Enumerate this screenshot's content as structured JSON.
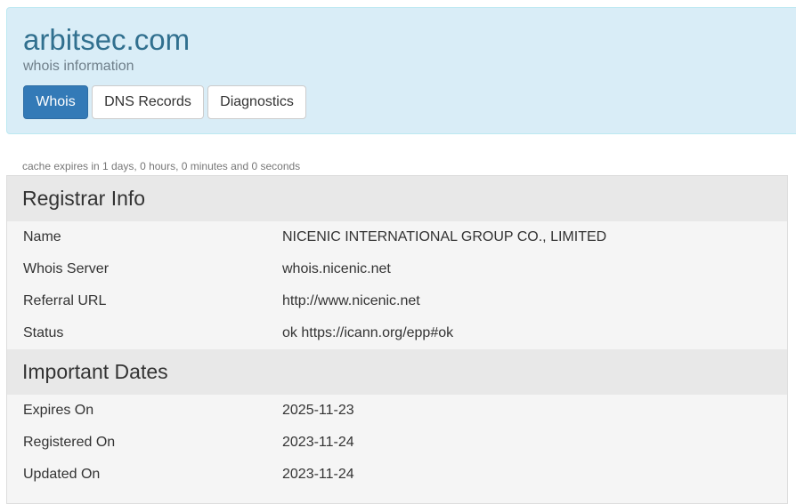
{
  "header": {
    "domain": "arbitsec.com",
    "subtitle": "whois information",
    "tabs": [
      {
        "label": "Whois",
        "active": true
      },
      {
        "label": "DNS Records",
        "active": false
      },
      {
        "label": "Diagnostics",
        "active": false
      }
    ]
  },
  "cache_note": "cache expires in 1 days, 0 hours, 0 minutes and 0 seconds",
  "sections": [
    {
      "title": "Registrar Info",
      "rows": [
        {
          "label": "Name",
          "value": "NICENIC INTERNATIONAL GROUP CO., LIMITED"
        },
        {
          "label": "Whois Server",
          "value": "whois.nicenic.net"
        },
        {
          "label": "Referral URL",
          "value": "http://www.nicenic.net"
        },
        {
          "label": "Status",
          "value": "ok https://icann.org/epp#ok"
        }
      ]
    },
    {
      "title": "Important Dates",
      "rows": [
        {
          "label": "Expires On",
          "value": "2025-11-23"
        },
        {
          "label": "Registered On",
          "value": "2023-11-24"
        },
        {
          "label": "Updated On",
          "value": "2023-11-24"
        }
      ]
    }
  ],
  "colors": {
    "header_bg": "#d9edf7",
    "title": "#31708f",
    "active_tab": "#337ab7",
    "panel_bg": "#f5f5f5",
    "section_head_bg": "#e8e8e8"
  }
}
